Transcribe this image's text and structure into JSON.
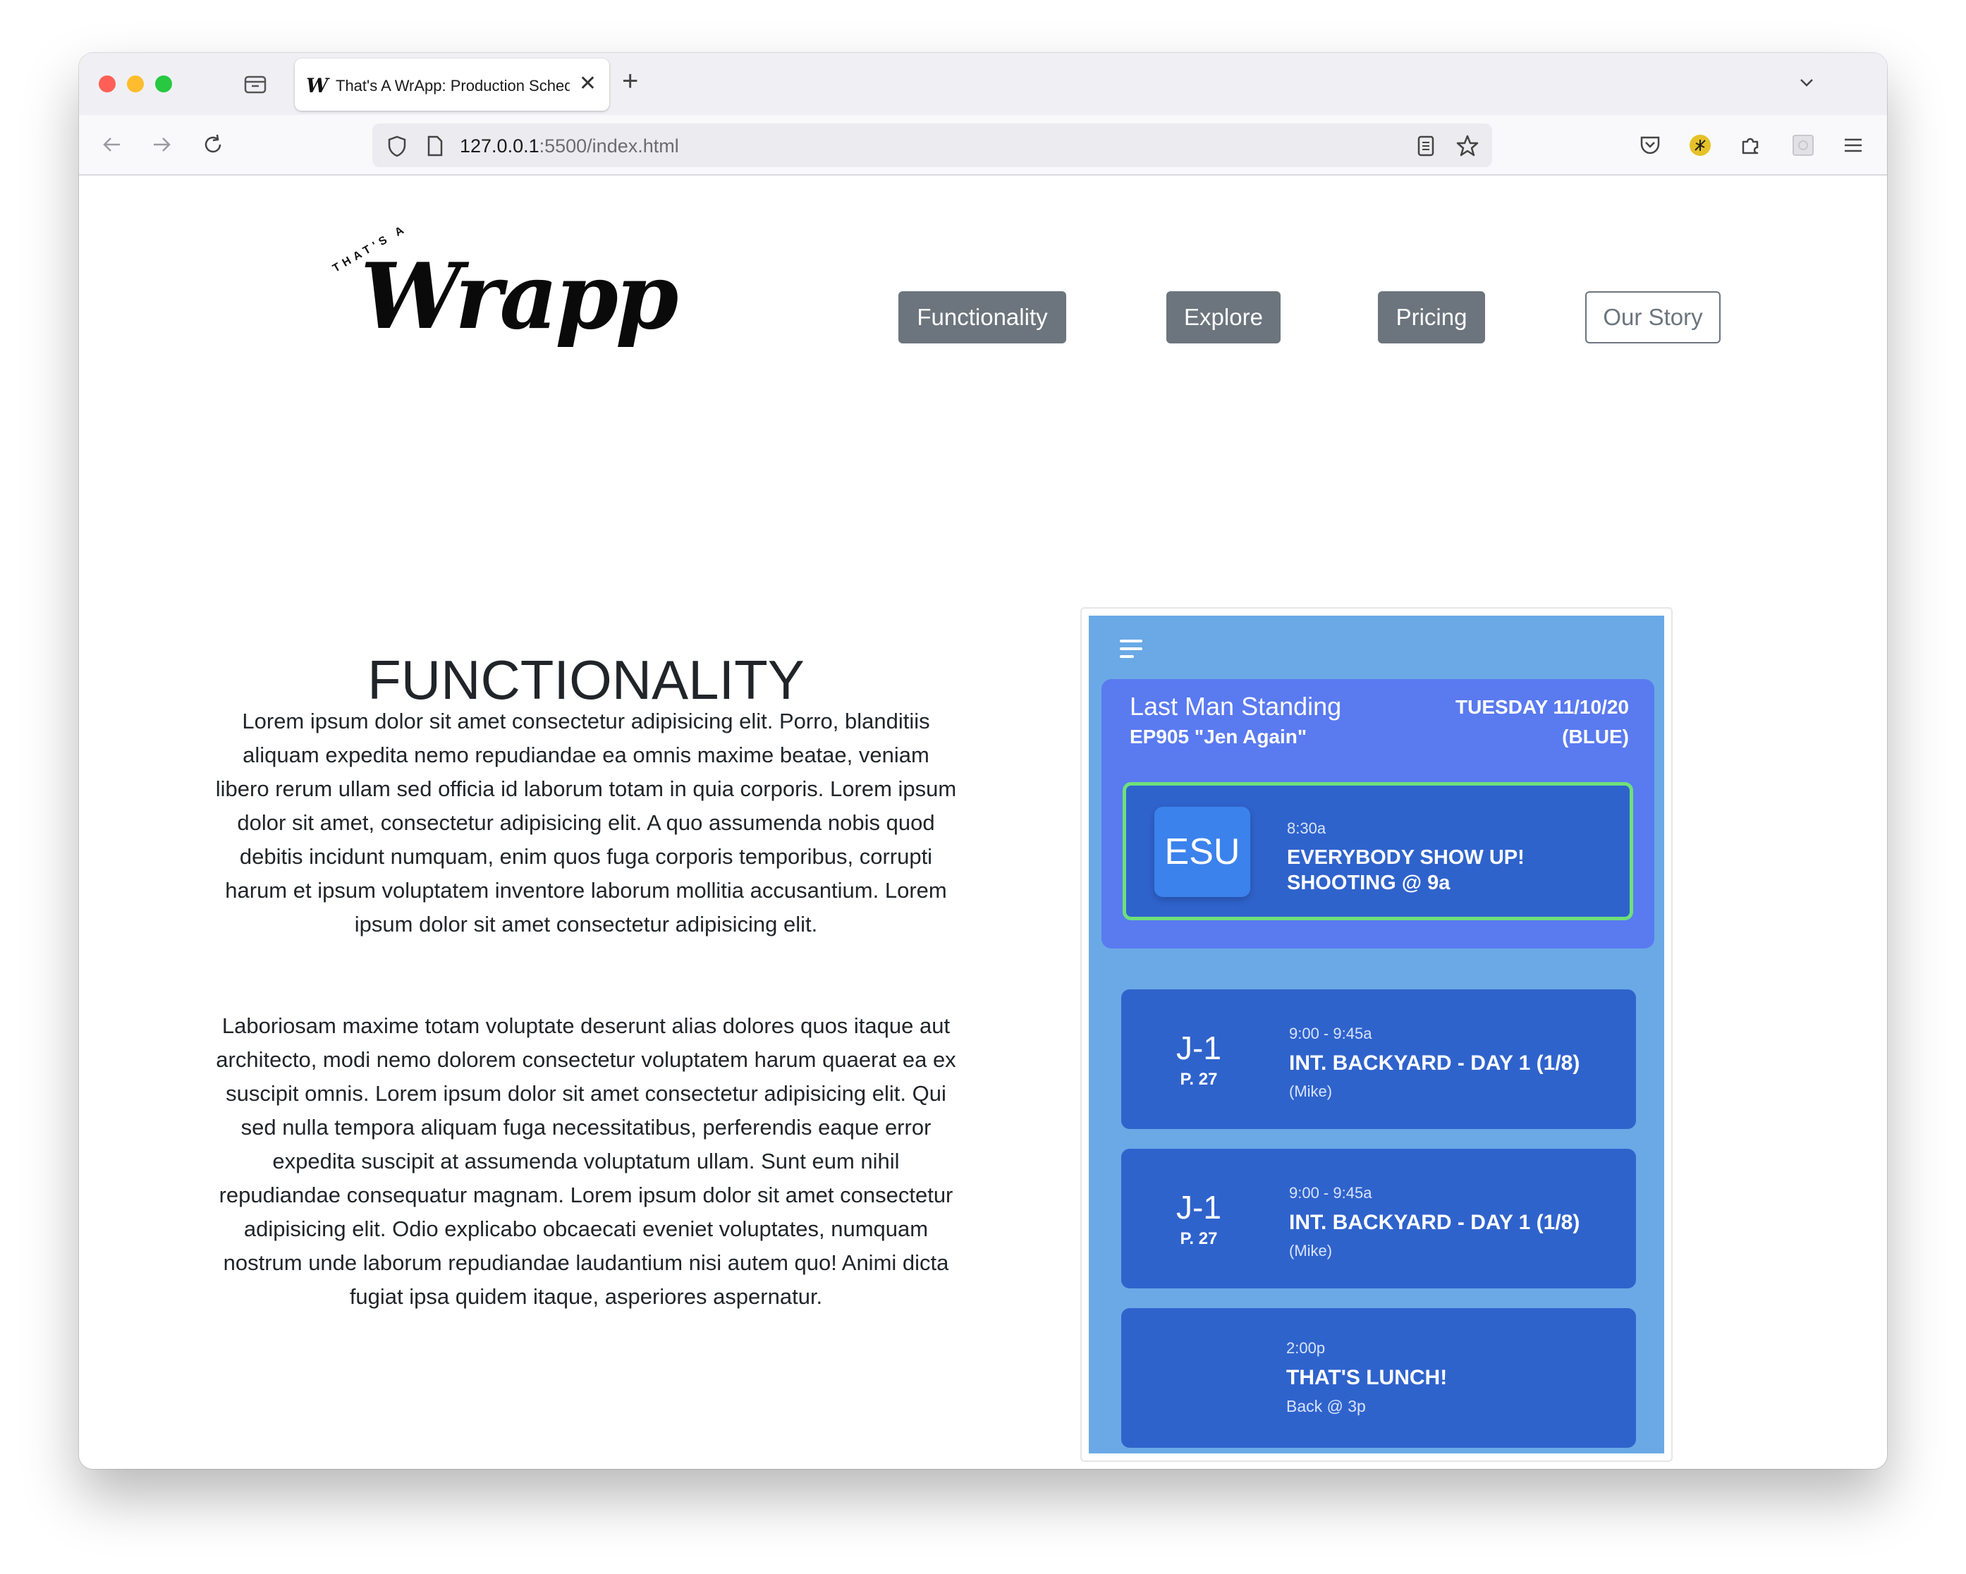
{
  "browser": {
    "tab_title": "That's A WrApp: Production Schedule",
    "tab_favicon": "W",
    "url_host": "127.0.0.1",
    "url_rest": ":5500/index.html",
    "new_tab_glyph": "+",
    "close_glyph": "✕",
    "icons": [
      "back-arrow-icon",
      "forward-arrow-icon",
      "reload-icon",
      "shield-icon",
      "page-icon",
      "reader-view-icon",
      "bookmark-star-icon",
      "pocket-icon",
      "extension-icon",
      "puzzle-icon",
      "grid-icon",
      "menu-icon"
    ]
  },
  "site": {
    "logo_small": "THAT'S A",
    "logo_main": "Wrapp",
    "nav": [
      {
        "label": "Functionality",
        "style": "solid"
      },
      {
        "label": "Explore",
        "style": "solid"
      },
      {
        "label": "Pricing",
        "style": "solid"
      },
      {
        "label": "Our Story",
        "style": "outline"
      }
    ],
    "heading": "FUNCTIONALITY",
    "paragraphs": [
      "Lorem ipsum dolor sit amet consectetur adipisicing elit. Porro, blanditiis aliquam expedita nemo repudiandae ea omnis maxime beatae, veniam libero rerum ullam sed officia id laborum totam in quia corporis. Lorem ipsum dolor sit amet, consectetur adipisicing elit. A quo assumenda nobis quod debitis incidunt numquam, enim quos fuga corporis temporibus, corrupti harum et ipsum voluptatem inventore laborum mollitia accusantium. Lorem ipsum dolor sit amet consectetur adipisicing elit.",
      "Laboriosam maxime totam voluptate deserunt alias dolores quos itaque aut architecto, modi nemo dolorem consectetur voluptatem harum quaerat ea ex suscipit omnis. Lorem ipsum dolor sit amet consectetur adipisicing elit. Qui sed nulla tempora aliquam fuga necessitatibus, perferendis eaque error expedita suscipit at assumenda voluptatum ullam. Sunt eum nihil repudiandae consequatur magnam. Lorem ipsum dolor sit amet consectetur adipisicing elit. Odio explicabo obcaecati eveniet voluptates, numquam nostrum unde laborum repudiandae laudantium nisi autem quo! Animi dicta fugiat ipsa quidem itaque, asperiores aspernatur."
    ],
    "scroll_top_icon": "arrow-up-icon"
  },
  "mock": {
    "show_title": "Last Man Standing",
    "episode": "EP905  \"Jen Again\"",
    "date": "TUESDAY  11/10/20",
    "unit": "(BLUE)",
    "esu": {
      "badge": "ESU",
      "time": "8:30a",
      "line1": "EVERYBODY SHOW UP!",
      "line2": "SHOOTING @ 9a"
    },
    "scenes": [
      {
        "id": "J-1",
        "page": "P. 27",
        "time": "9:00 - 9:45a",
        "title": "INT. BACKYARD - DAY 1 (1/8)",
        "cast": "(Mike)"
      },
      {
        "id": "J-1",
        "page": "P. 27",
        "time": "9:00 - 9:45a",
        "title": "INT. BACKYARD - DAY 1 (1/8)",
        "cast": "(Mike)"
      }
    ],
    "lunch": {
      "time": "2:00p",
      "title": "THAT'S LUNCH!",
      "sub": "Back @ 3p"
    }
  },
  "colors": {
    "nav_button": "#6c757d",
    "mock_background": "#6aa9e6",
    "header_card": "#5a7af0",
    "scene_card": "#2f63cc",
    "esu_border": "#6ee07a"
  }
}
